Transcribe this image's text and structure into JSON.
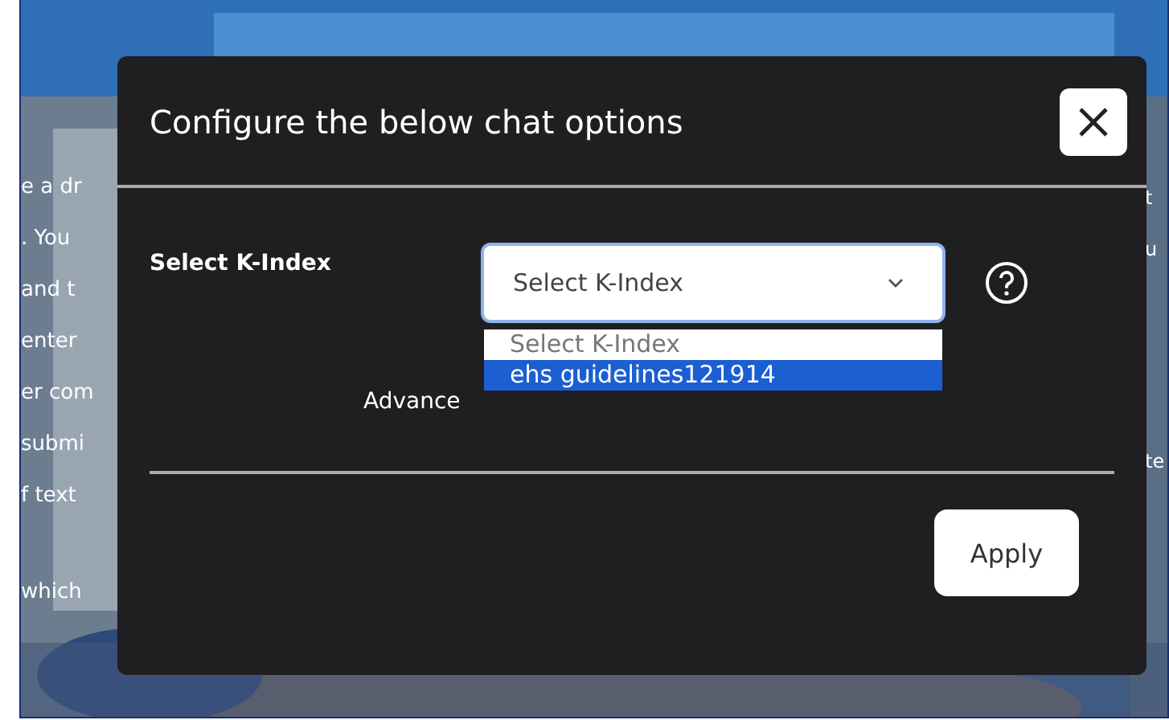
{
  "background_text": {
    "left": [
      "e a dr",
      ". You",
      "and t",
      "enter",
      "er com",
      "submi",
      "f text",
      "which"
    ],
    "right": [
      "t",
      "u",
      "te"
    ]
  },
  "dialog": {
    "title": "Configure the below chat options",
    "k_index": {
      "label": "Select K-Index",
      "value": "Select K-Index",
      "expanded": true,
      "options": [
        {
          "label": "Select K-Index",
          "selected": true,
          "highlighted": false
        },
        {
          "label": "ehs guidelines121914",
          "selected": false,
          "highlighted": true
        }
      ]
    },
    "advanced_label": "Advance",
    "apply_button": "Apply"
  }
}
